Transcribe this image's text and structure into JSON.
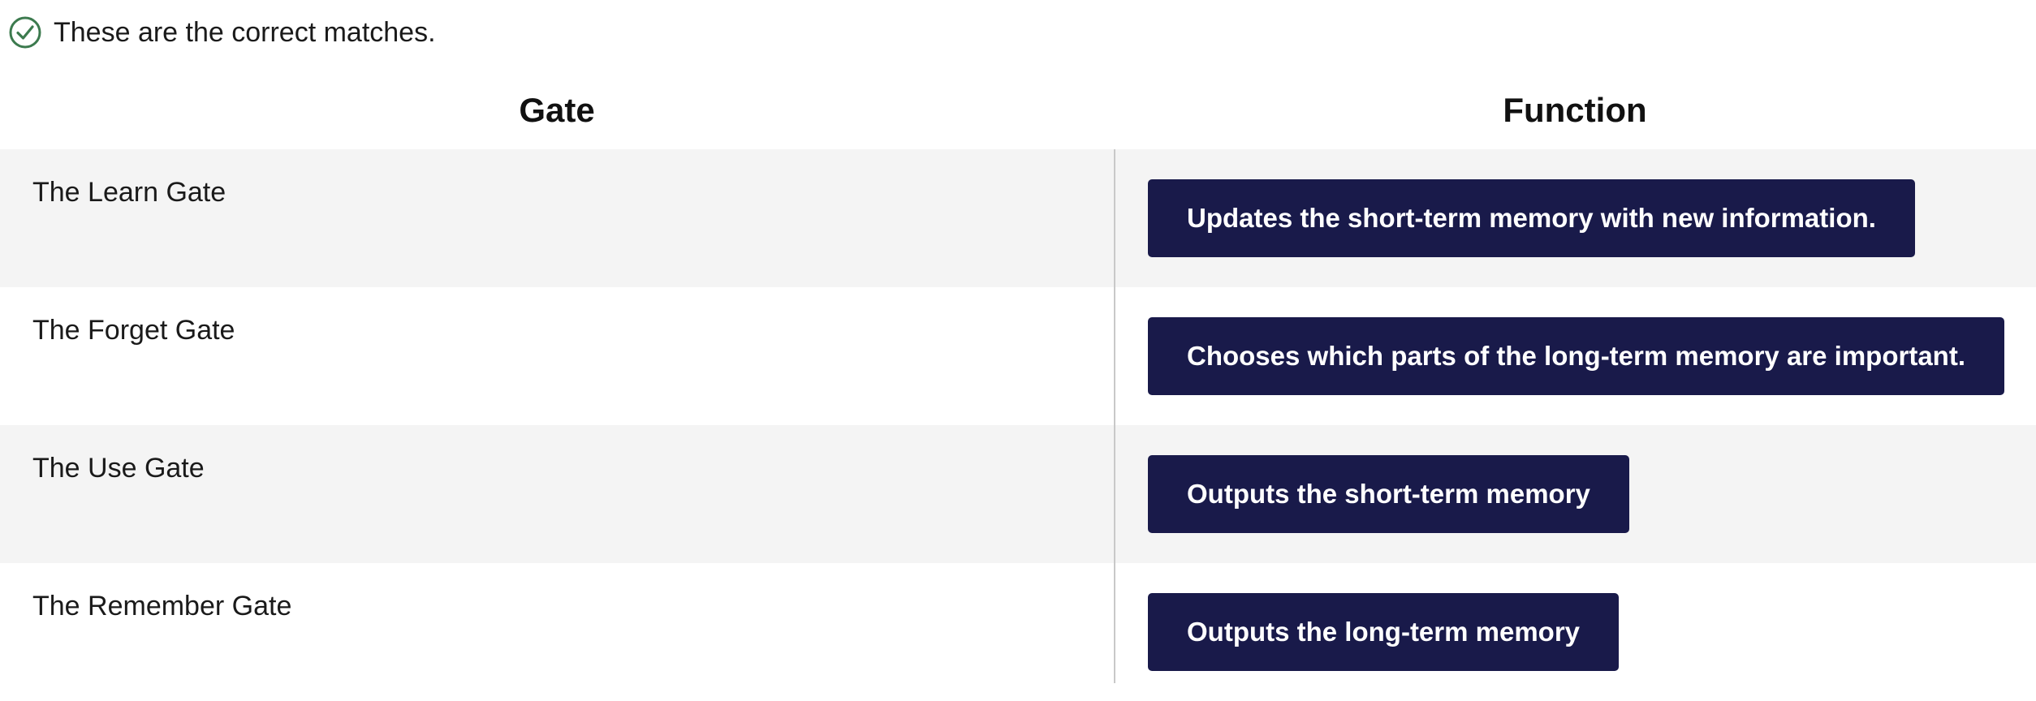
{
  "feedback": {
    "icon": "check-circle-icon",
    "color": "#3c7a4e",
    "text": "These are the correct matches."
  },
  "table": {
    "headers": {
      "left": "Gate",
      "right": "Function"
    },
    "rows": [
      {
        "gate": "The Learn Gate",
        "function": "Updates the short-term memory with new information."
      },
      {
        "gate": "The Forget Gate",
        "function": "Chooses which parts of the long-term memory are important."
      },
      {
        "gate": "The Use Gate",
        "function": "Outputs the short-term memory"
      },
      {
        "gate": "The Remember Gate",
        "function": "Outputs the long-term memory"
      }
    ]
  },
  "colors": {
    "answer_bg": "#191a4a",
    "answer_text": "#ffffff",
    "row_shade": "#f4f4f4",
    "divider": "#c8c8c8"
  }
}
